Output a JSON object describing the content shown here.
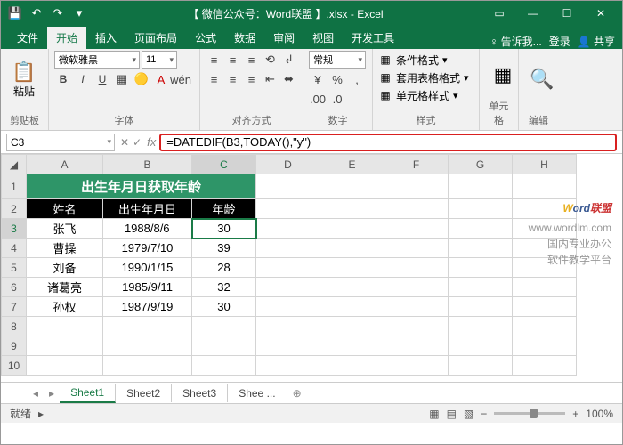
{
  "title": "【 微信公众号：Word联盟 】.xlsx - Excel",
  "tabs": {
    "file": "文件",
    "home": "开始",
    "insert": "插入",
    "layout": "页面布局",
    "formulas": "公式",
    "data": "数据",
    "review": "审阅",
    "view": "视图",
    "dev": "开发工具",
    "tell": "告诉我...",
    "login": "登录",
    "share": "共享"
  },
  "ribbon": {
    "clipboard": {
      "paste": "粘贴",
      "label": "剪贴板"
    },
    "font": {
      "name": "微软雅黑",
      "size": "11",
      "label": "字体"
    },
    "align": {
      "label": "对齐方式"
    },
    "number": {
      "format": "常规",
      "label": "数字"
    },
    "styles": {
      "cond": "条件格式",
      "table": "套用表格格式",
      "cell": "单元格样式",
      "label": "样式"
    },
    "cells": {
      "label": "单元格"
    },
    "editing": {
      "label": "编辑"
    }
  },
  "cellref": "C3",
  "formula": "=DATEDIF(B3,TODAY(),\"y\")",
  "cols": [
    "A",
    "B",
    "C",
    "D",
    "E",
    "F",
    "G",
    "H"
  ],
  "table": {
    "title": "出生年月日获取年龄",
    "headers": [
      "姓名",
      "出生年月日",
      "年龄"
    ],
    "rows": [
      [
        "张飞",
        "1988/8/6",
        "30"
      ],
      [
        "曹操",
        "1979/7/10",
        "39"
      ],
      [
        "刘备",
        "1990/1/15",
        "28"
      ],
      [
        "诸葛亮",
        "1985/9/11",
        "32"
      ],
      [
        "孙权",
        "1987/9/19",
        "30"
      ]
    ]
  },
  "watermark": {
    "logo_a": "W",
    "logo_b": "ord",
    "logo_c": "联盟",
    "url": "www.wordlm.com",
    "line1": "国内专业办公",
    "line2": "软件教学平台"
  },
  "sheets": [
    "Sheet1",
    "Sheet2",
    "Sheet3",
    "Shee ..."
  ],
  "status": {
    "ready": "就绪",
    "zoom": "100%"
  }
}
